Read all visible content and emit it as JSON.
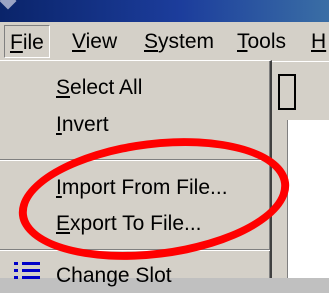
{
  "menubar": {
    "items": [
      {
        "mnemonic": "F",
        "rest": "ile"
      },
      {
        "mnemonic": "V",
        "rest": "iew"
      },
      {
        "mnemonic": "S",
        "rest": "ystem"
      },
      {
        "mnemonic": "T",
        "rest": "ools"
      },
      {
        "mnemonic": "H",
        "rest": ""
      }
    ]
  },
  "file_menu": {
    "items": [
      {
        "mnemonic": "S",
        "rest": "elect All"
      },
      {
        "mnemonic": "I",
        "rest": "nvert"
      },
      {
        "mnemonic": "I",
        "rest": "mport From File..."
      },
      {
        "mnemonic": "E",
        "rest": "xport To File..."
      },
      {
        "label": "Change Slot"
      }
    ]
  },
  "annotation": {
    "color": "#ff0000"
  }
}
